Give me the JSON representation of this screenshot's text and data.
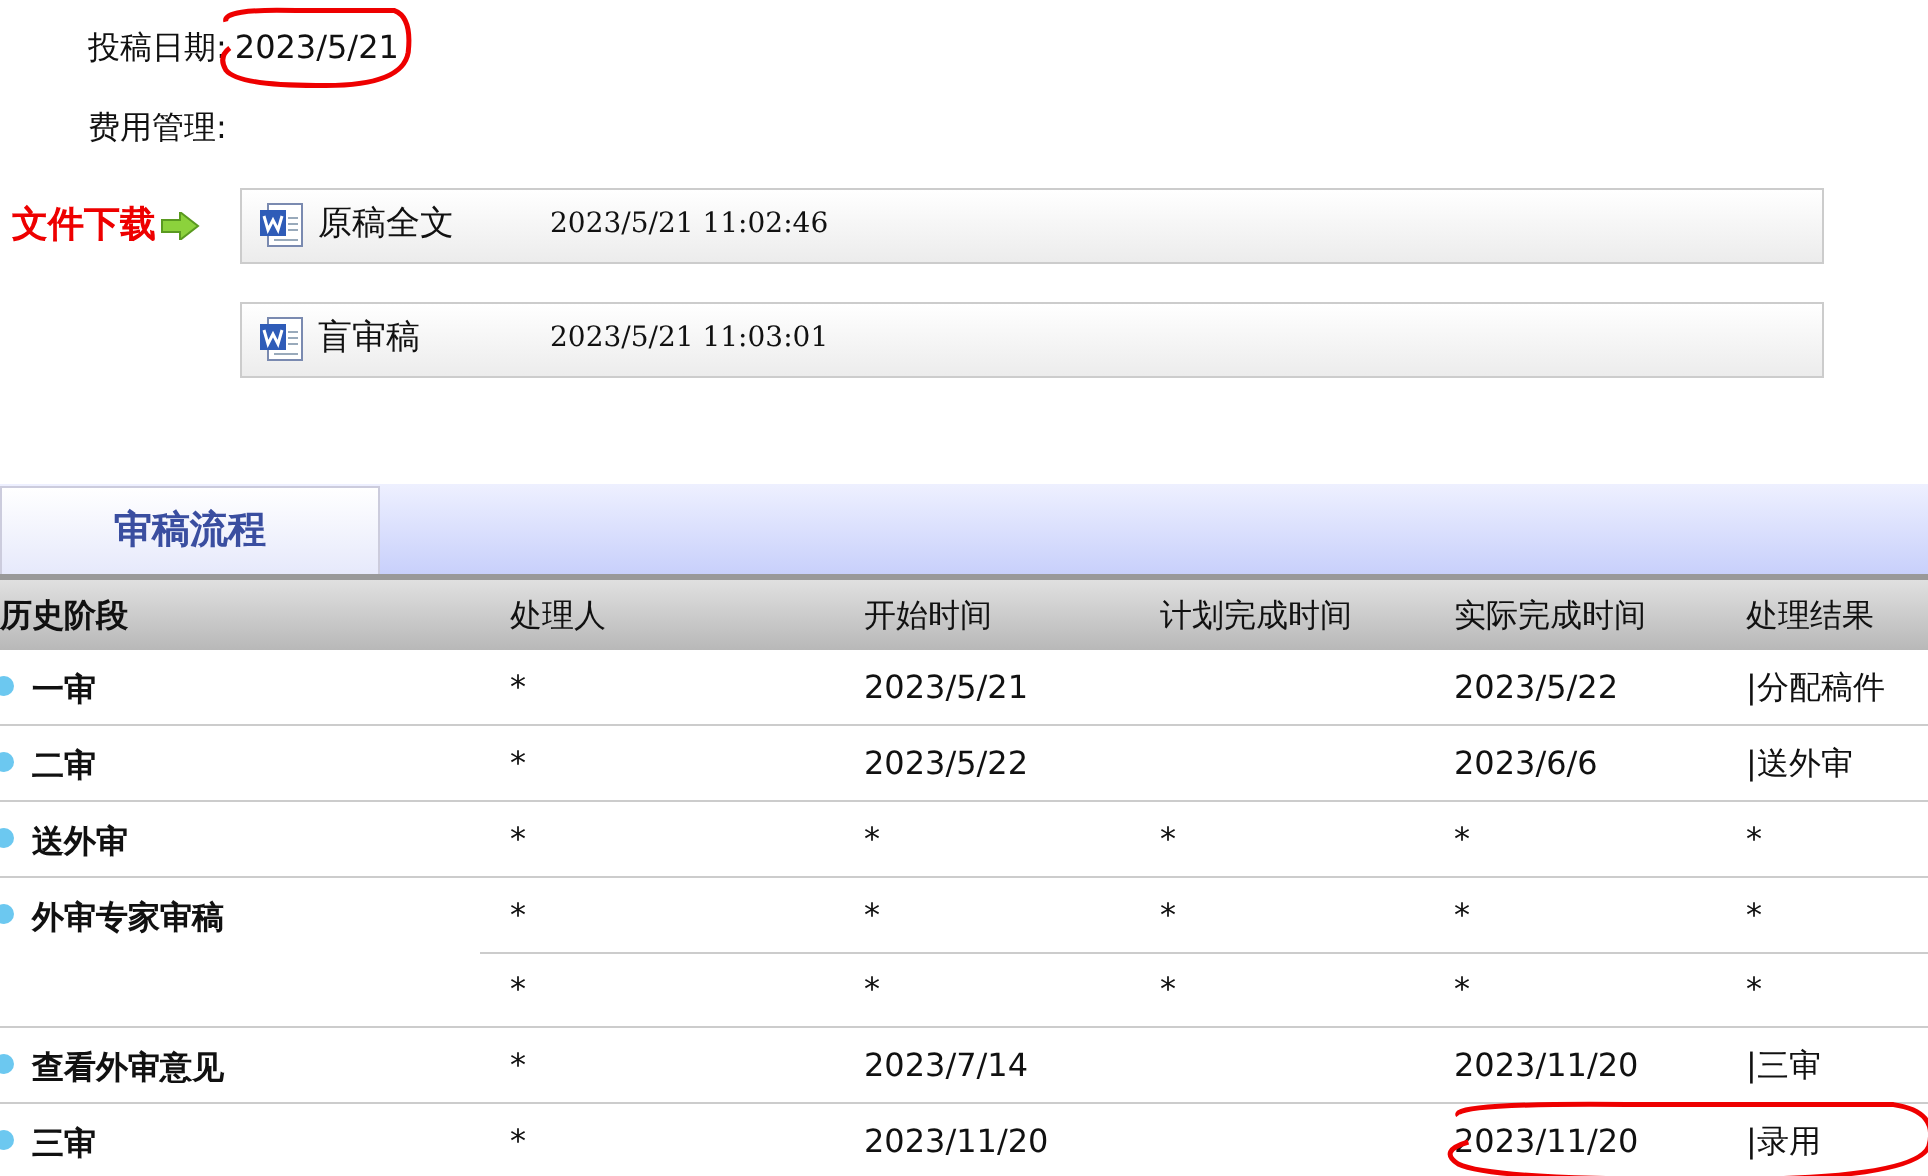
{
  "fields": [
    {
      "label": "投稿日期:",
      "value": "2023/5/21",
      "circled": true
    },
    {
      "label": "费用管理:"
    }
  ],
  "downloads": {
    "label": "文件下载",
    "files": [
      {
        "name": "原稿全文",
        "time": "2023/5/21 11:02:46"
      },
      {
        "name": "盲审稿",
        "time": "2023/5/21 11:03:01"
      }
    ]
  },
  "tabs": [
    {
      "label": "审稿流程",
      "selected": true
    }
  ],
  "table": {
    "columns": [
      "历史阶段",
      "处理人",
      "开始时间",
      "计划完成时间",
      "实际完成时间",
      "处理结果"
    ],
    "stages": [
      {
        "name": "一审",
        "entries": [
          {
            "handler": "*",
            "start": "2023/5/21",
            "actual": "2023/5/22",
            "result": "|分配稿件"
          }
        ]
      },
      {
        "name": "二审",
        "entries": [
          {
            "handler": "*",
            "start": "2023/5/22",
            "actual": "2023/6/6",
            "result": "|送外审"
          }
        ]
      },
      {
        "name": "送外审",
        "entries": [
          {
            "handler": "*",
            "start": "*",
            "planned": "*",
            "actual": "*",
            "result": "*"
          }
        ]
      },
      {
        "name": "外审专家审稿",
        "entries": [
          {
            "handler": "*",
            "start": "*",
            "planned": "*",
            "actual": "*",
            "result": "*"
          },
          {
            "handler": "*",
            "start": "*",
            "planned": "*",
            "actual": "*",
            "result": "*"
          }
        ]
      },
      {
        "name": "查看外审意见",
        "entries": [
          {
            "handler": "*",
            "start": "2023/7/14",
            "actual": "2023/11/20",
            "result": "|三审"
          }
        ]
      },
      {
        "name": "三审",
        "entries": [
          {
            "handler": "*",
            "start": "2023/11/20",
            "actual": "2023/11/20",
            "result": "|录用",
            "circled": true
          }
        ]
      }
    ]
  }
}
